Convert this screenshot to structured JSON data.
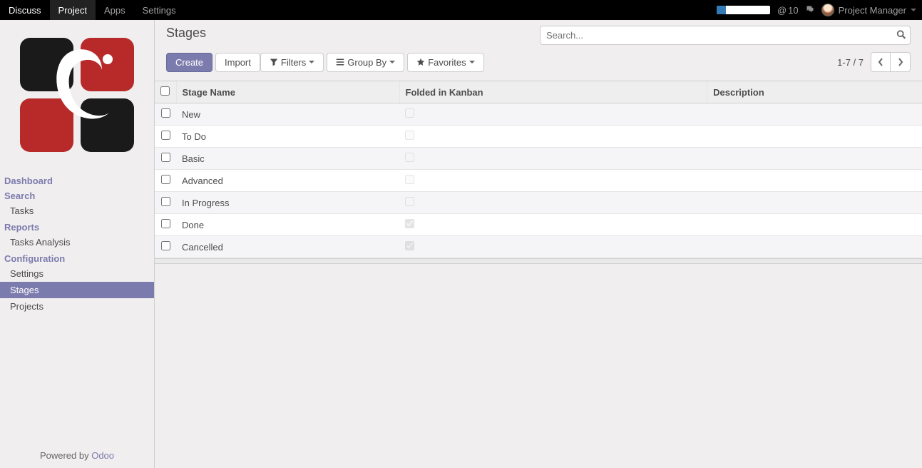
{
  "navbar": {
    "items": [
      "Discuss",
      "Project",
      "Apps",
      "Settings"
    ],
    "active_index": 1,
    "notification_count": "10",
    "user_name": "Project Manager"
  },
  "sidebar": {
    "sections": [
      {
        "label": "Dashboard",
        "items": []
      },
      {
        "label": "Search",
        "items": [
          "Tasks"
        ]
      },
      {
        "label": "Reports",
        "items": [
          "Tasks Analysis"
        ]
      },
      {
        "label": "Configuration",
        "items": [
          "Settings",
          "Stages",
          "Projects"
        ]
      }
    ],
    "active_item": "Stages",
    "footer_prefix": "Powered by ",
    "footer_link": "Odoo"
  },
  "control_panel": {
    "title": "Stages",
    "create_label": "Create",
    "import_label": "Import",
    "search_placeholder": "Search...",
    "filters_label": "Filters",
    "groupby_label": "Group By",
    "favorites_label": "Favorites",
    "pager": "1-7 / 7"
  },
  "table": {
    "columns": [
      "Stage Name",
      "Folded in Kanban",
      "Description"
    ],
    "rows": [
      {
        "name": "New",
        "folded": false,
        "description": ""
      },
      {
        "name": "To Do",
        "folded": false,
        "description": ""
      },
      {
        "name": "Basic",
        "folded": false,
        "description": ""
      },
      {
        "name": "Advanced",
        "folded": false,
        "description": ""
      },
      {
        "name": "In Progress",
        "folded": false,
        "description": ""
      },
      {
        "name": "Done",
        "folded": true,
        "description": ""
      },
      {
        "name": "Cancelled",
        "folded": true,
        "description": ""
      }
    ]
  }
}
